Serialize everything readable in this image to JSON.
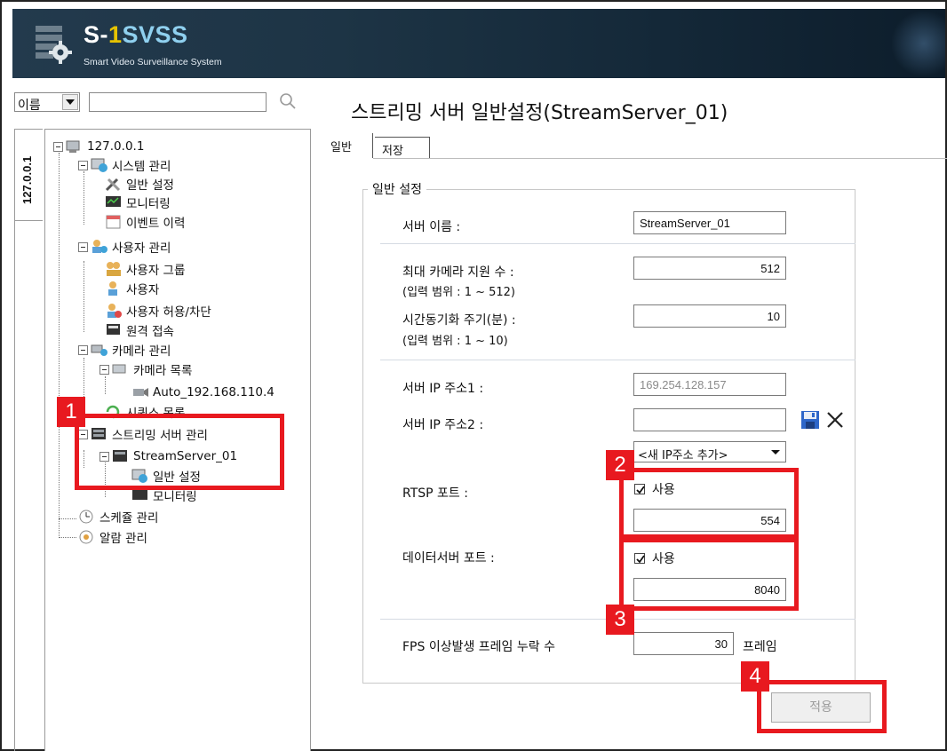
{
  "header": {
    "title_s": "S-",
    "title_num": "1",
    "title_svss": "SVSS",
    "subtitle": "Smart Video Surveillance System"
  },
  "search": {
    "select_value": "이름"
  },
  "side_tab": {
    "label": "127.0.0.1"
  },
  "tree": {
    "root": "127.0.0.1",
    "system_mgmt": "시스템 관리",
    "general_settings": "일반 설정",
    "monitoring": "모니터링",
    "event_history": "이벤트 이력",
    "user_mgmt": "사용자 관리",
    "user_group": "사용자 그룹",
    "user": "사용자",
    "user_allow_block": "사용자 허용/차단",
    "remote_access": "원격 접속",
    "camera_mgmt": "카메라 관리",
    "camera_list": "카메라 목록",
    "camera_item": "Auto_192.168.110.4",
    "sequence_list": "시퀀스 목록",
    "streaming_server_mgmt": "스트리밍 서버 관리",
    "stream_server": "StreamServer_01",
    "ss_general_settings": "일반 설정",
    "ss_monitoring": "모니터링",
    "schedule_mgmt": "스케쥴 관리",
    "alarm_mgmt": "알람 관리"
  },
  "badges": [
    "1",
    "2",
    "3",
    "4"
  ],
  "main": {
    "title": "스트리밍 서버 일반설정(StreamServer_01)",
    "tabs": [
      {
        "label": "일반"
      },
      {
        "label": "저장"
      }
    ],
    "group_title": "일반 설정",
    "server_name_label": "서버 이름 :",
    "server_name_value": "StreamServer_01",
    "max_cameras_label": "최대 카메라 지원 수 :",
    "max_cameras_range": "(입력 범위 : 1 ~ 512)",
    "max_cameras_value": "512",
    "time_sync_label": "시간동기화 주기(분) :",
    "time_sync_range": "(입력 범위 : 1 ~ 10)",
    "time_sync_value": "10",
    "ip1_label": "서버 IP 주소1 :",
    "ip1_value": "169.254.128.157",
    "ip2_label": "서버 IP 주소2 :",
    "ip2_value": "",
    "ip_dropdown": "<새 IP주소 추가>",
    "rtsp_label": "RTSP 포트 :",
    "rtsp_use_label": "사용",
    "rtsp_use_checked": true,
    "rtsp_value": "554",
    "dataserver_label": "데이터서버 포트 :",
    "dataserver_use_label": "사용",
    "dataserver_use_checked": true,
    "dataserver_value": "8040",
    "fps_label": "FPS 이상발생 프레임 누락 수",
    "fps_value": "30",
    "fps_unit": "프레임",
    "apply_button": "적용"
  },
  "colors": {
    "highlight_red": "#e8191f",
    "header_bg": "#1d3445",
    "logo_yellow": "#e6c300",
    "logo_blue": "#8fd0ef"
  },
  "icons": {
    "logo": "server-gear-icon",
    "search": "search-icon",
    "save": "floppy-save-icon",
    "delete": "close-x-icon"
  }
}
